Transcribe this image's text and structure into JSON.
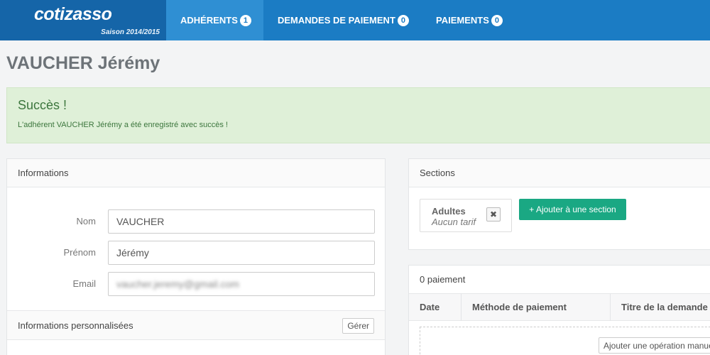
{
  "brand": {
    "name": "cotizasso",
    "season": "Saison 2014/2015"
  },
  "nav": [
    {
      "label": "ADHÉRENTS",
      "badge": "1"
    },
    {
      "label": "DEMANDES DE PAIEMENT",
      "badge": "0"
    },
    {
      "label": "PAIEMENTS",
      "badge": "0"
    }
  ],
  "page": {
    "title": "VAUCHER Jérémy"
  },
  "alert": {
    "title": "Succès !",
    "message": "L'adhérent VAUCHER Jérémy a été enregistré avec succès !"
  },
  "info": {
    "heading": "Informations",
    "fields": [
      {
        "label": "Nom",
        "value": "VAUCHER"
      },
      {
        "label": "Prénom",
        "value": "Jérémy"
      },
      {
        "label": "Email",
        "value": "vaucher.jeremy@gmail.com"
      }
    ],
    "custom_heading": "Informations personnalisées",
    "manage_label": "Gérer"
  },
  "sections": {
    "heading": "Sections",
    "chip": {
      "name": "Adultes",
      "tarif": "Aucun tarif",
      "remove": "✖"
    },
    "add_label": "+ Ajouter à une section"
  },
  "payments": {
    "heading": "0 paiement",
    "columns": [
      "Date",
      "Méthode de paiement",
      "Titre de la demande"
    ],
    "add_op_label": "Ajouter une opération manuelle"
  },
  "colors": {
    "navbar": "#1b7cc4",
    "brand": "#1565a8",
    "success_bg": "#dff0d8",
    "button_green": "#1aa883"
  }
}
